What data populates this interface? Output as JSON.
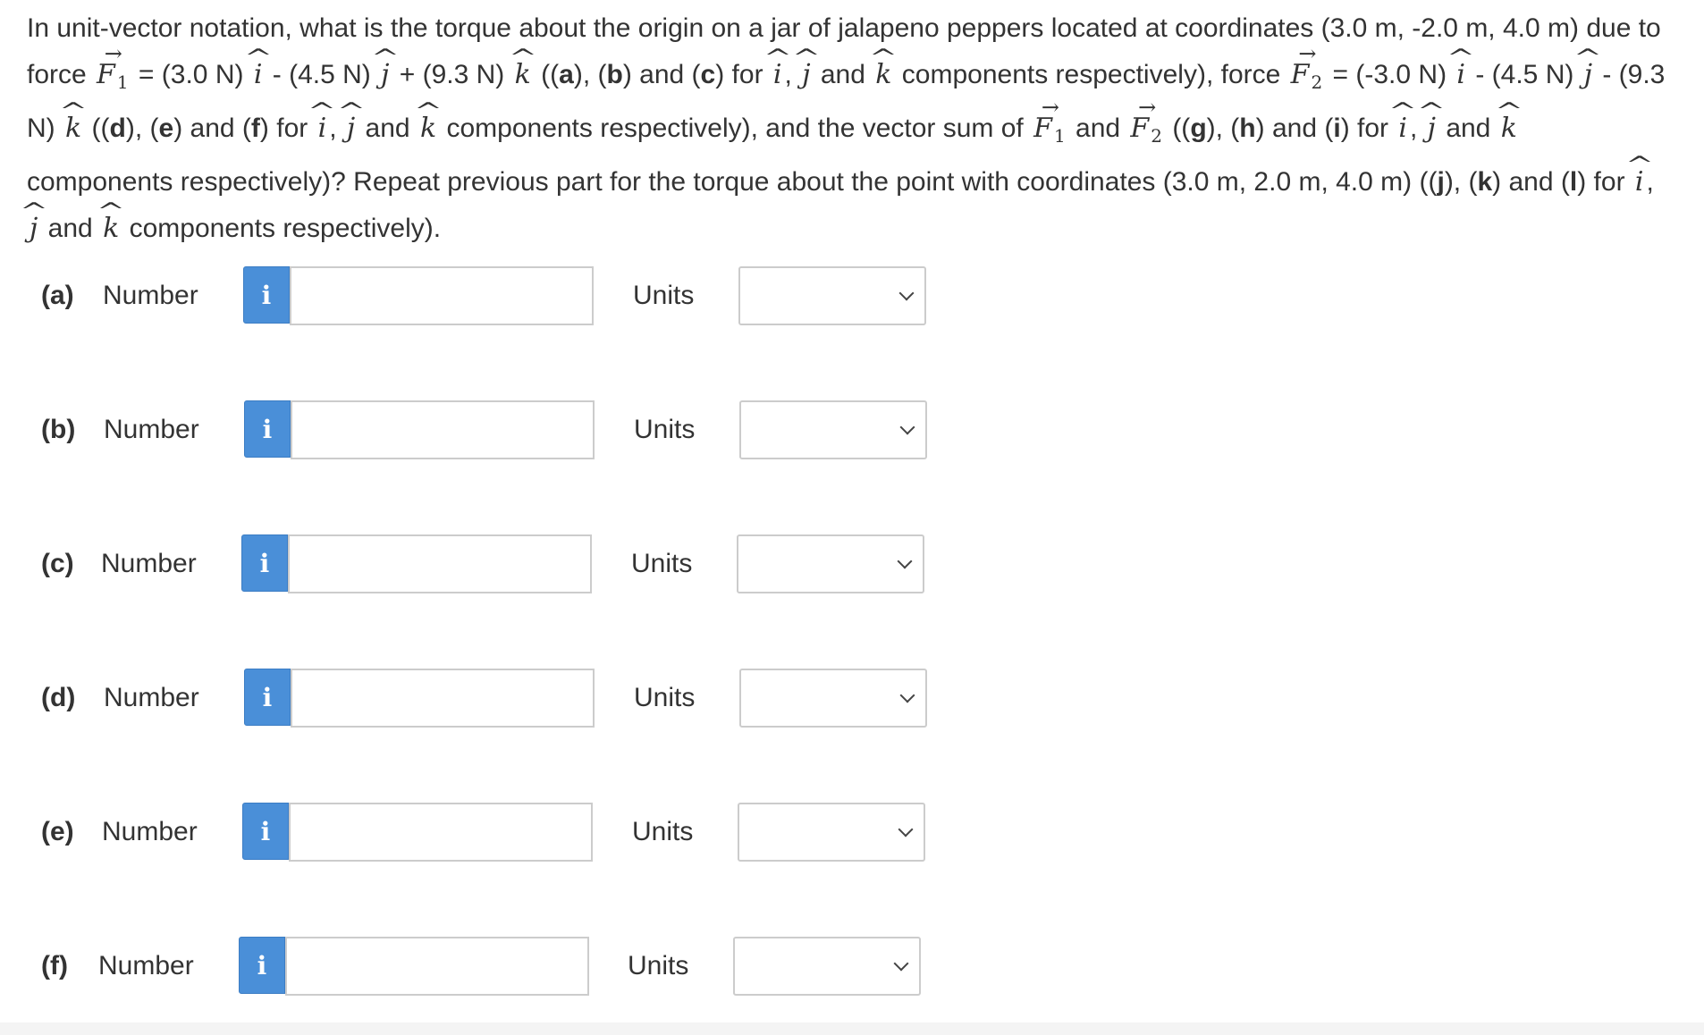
{
  "question": {
    "t1": "In unit-vector notation, what is the torque about the origin on a jar of jalapeno peppers located at coordinates (3.0 m, -2.0 m, 4.0 m) due to force ",
    "F": "F",
    "sub1": "1",
    "sub2": "2",
    "i": "i",
    "j": "j",
    "k": "k",
    "comma": ",",
    "and": "and",
    "t2": " = (3.0 N) ",
    "t3": " - (4.5 N) ",
    "t4": " + (9.3 N) ",
    "t5": " ((",
    "pa": "a",
    "t6": "), (",
    "pb": "b",
    "t7": ") and (",
    "pc": "c",
    "t8": ") for ",
    "t9": " components respectively), force ",
    "t10": " = (-3.0 N) ",
    "t11": " - (4.5 N) ",
    "t12": " - (9.3 N) ",
    "t13": " ((",
    "pd": "d",
    "t14": "), (",
    "pe": "e",
    "t15": ") and (",
    "pf": "f",
    "t16": ") for ",
    "t17": " components respectively), and the vector sum of ",
    "t18": " ((",
    "pg": "g",
    "t19": "), (",
    "ph": "h",
    "t20": ") and (",
    "pi": "i",
    "t21": ") for ",
    "t22": " components respectively)? Repeat previous part for the torque about the point with coordinates (3.0 m, 2.0 m, 4.0 m) ((",
    "pj": "j",
    "t23": "), (",
    "pk": "k",
    "t24": ") and (",
    "pl": "l",
    "t25": ") for ",
    "t26": " components respectively)."
  },
  "rows": [
    {
      "part": "(a)",
      "number_label": "Number",
      "info": "i",
      "value": "",
      "units_label": "Units",
      "units_value": ""
    },
    {
      "part": "(b)",
      "number_label": "Number",
      "info": "i",
      "value": "",
      "units_label": "Units",
      "units_value": ""
    },
    {
      "part": "(c)",
      "number_label": "Number",
      "info": "i",
      "value": "",
      "units_label": "Units",
      "units_value": ""
    },
    {
      "part": "(d)",
      "number_label": "Number",
      "info": "i",
      "value": "",
      "units_label": "Units",
      "units_value": ""
    },
    {
      "part": "(e)",
      "number_label": "Number",
      "info": "i",
      "value": "",
      "units_label": "Units",
      "units_value": ""
    },
    {
      "part": "(f)",
      "number_label": "Number",
      "info": "i",
      "value": "",
      "units_label": "Units",
      "units_value": ""
    }
  ],
  "colors": {
    "info_button": "#4a8fd8",
    "input_border": "#cccccc",
    "text": "#333333"
  },
  "icons": {
    "info": "info-icon",
    "dropdown": "chevron-down-icon"
  }
}
